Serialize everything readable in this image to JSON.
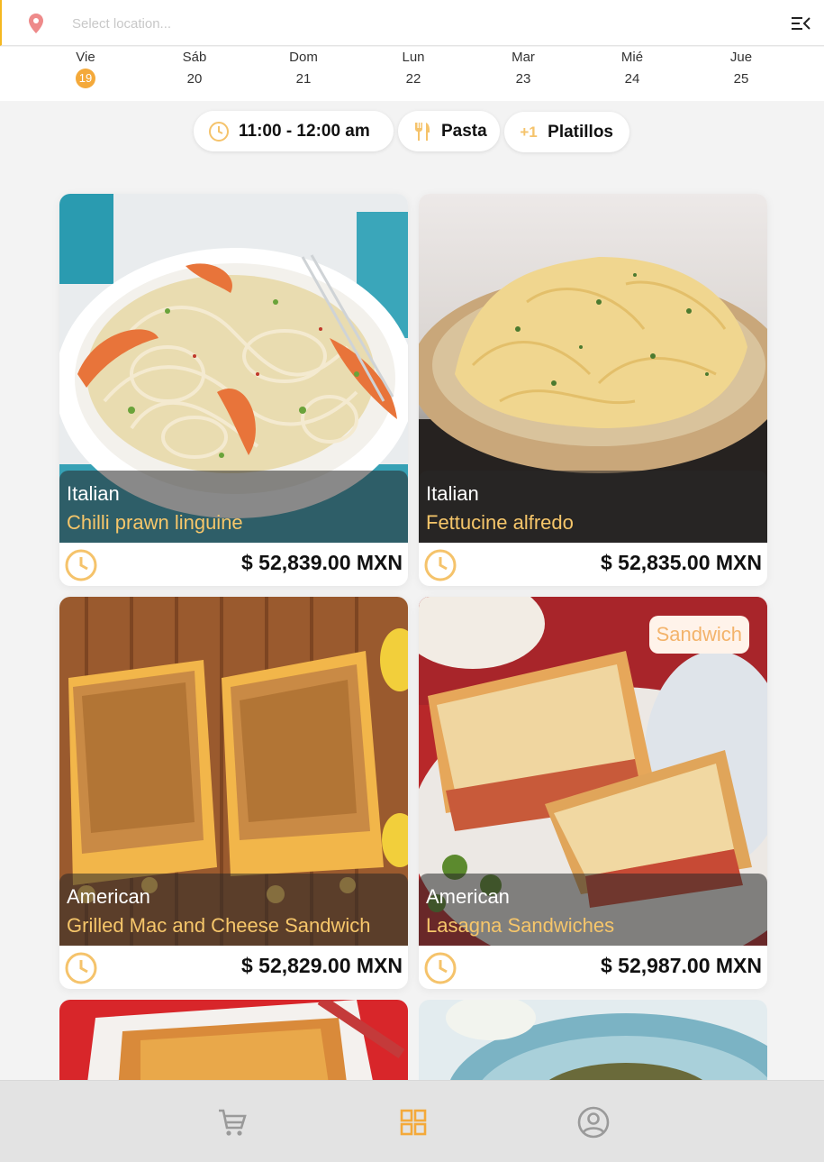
{
  "topbar": {
    "location_placeholder": "Select location...",
    "location_value": ""
  },
  "days": [
    {
      "name": "Vie",
      "date": "19",
      "selected": true
    },
    {
      "name": "Sáb",
      "date": "20"
    },
    {
      "name": "Dom",
      "date": "21"
    },
    {
      "name": "Lun",
      "date": "22"
    },
    {
      "name": "Mar",
      "date": "23"
    },
    {
      "name": "Mié",
      "date": "24"
    },
    {
      "name": "Jue",
      "date": "25"
    }
  ],
  "filters": {
    "time": {
      "label": "11:00 - 12:00 am",
      "icon": "clock-icon"
    },
    "category": {
      "label": "Pasta",
      "icon": "fork-knife-icon"
    },
    "dishes": {
      "prefix": "+1",
      "label": "Platillos"
    }
  },
  "cards": [
    {
      "cuisine": "Italian",
      "dish": "Chilli prawn linguine",
      "price": "$ 52,839.00 MXN"
    },
    {
      "cuisine": "Italian",
      "dish": "Fettucine alfredo",
      "price": "$ 52,835.00 MXN"
    },
    {
      "cuisine": "American",
      "dish": "Grilled Mac and Cheese Sandwich",
      "price": "$ 52,829.00 MXN"
    },
    {
      "cuisine": "American",
      "dish": "Lasagna Sandwiches",
      "price": "$ 52,987.00 MXN",
      "tag": "Sandwich"
    }
  ],
  "colors": {
    "accent": "#f4a93a",
    "dish_text": "#f6c66a",
    "icon_inactive": "#9a9a9a"
  },
  "bottom_nav": [
    "cart-icon",
    "grid-icon",
    "account-icon"
  ]
}
